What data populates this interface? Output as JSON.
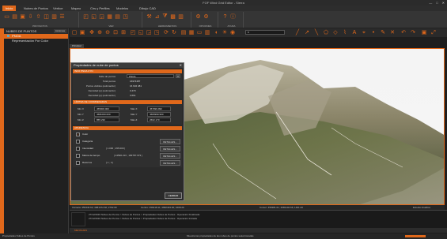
{
  "app": {
    "title": "FOF Wind Grid Editor - Sierra"
  },
  "window_buttons": [
    "—",
    "□",
    "✕"
  ],
  "menu_tabs": [
    "Inicio",
    "Nubes de Puntos",
    "Vértice",
    "Mapeo",
    "Cirs y Perfiles",
    "Modelos",
    "Dibujo CAD"
  ],
  "ribbon": {
    "groups": [
      "PROYECTOS",
      "VER",
      "HERRAMIENTAS",
      "OPCIONES",
      "AYUDA"
    ]
  },
  "left_panel": {
    "title": "NUBES DE PUNTOS",
    "action": "Acciones",
    "items": [
      {
        "label": "PNOA"
      },
      {
        "label": "Representación Por Color"
      }
    ]
  },
  "view_toolbar": {
    "select_value": "8"
  },
  "view_tab": {
    "label": "Principal"
  },
  "dialog": {
    "title": "Propiedades de nube de puntos",
    "close": "✕",
    "section_info": "INFO PNOA CYN",
    "rows": [
      {
        "label": "Nube de puntos",
        "value": "PNOA"
      },
      {
        "label": "Total puntos",
        "value": "16974487"
      },
      {
        "label": "Puntos visibles (estimación)",
        "value": "16 634 481"
      },
      {
        "label": "Densidad (p) (estimación)",
        "value": "0.470"
      },
      {
        "label": "Densidad (p) (estimación)",
        "value": "3.661"
      }
    ],
    "section_limits": "LÍMITES DE COORDENADAS",
    "limits": [
      {
        "l1": "Mín.X",
        "v1": "455000.000",
        "l2": "Máx.X",
        "v2": "457999.990"
      },
      {
        "l1": "Mín.Y",
        "v1": "4681000.000",
        "l2": "Máx.Y",
        "v2": "4683999.990"
      },
      {
        "l1": "Mín.Z",
        "v1": "855.230",
        "l2": "Máx.Z",
        "v2": "2662.170"
      }
    ],
    "section_appearance": "APARIENCIA",
    "appearance": [
      {
        "label": "Color",
        "range": "",
        "detail": ""
      },
      {
        "label": "Categoría",
        "range": "",
        "detail": "DETALLES..."
      },
      {
        "label": "Intensidad",
        "range": "[ 1.000 ; 255.000 ]",
        "detail": "DETALLES..."
      },
      {
        "label": "Marca de tiempo",
        "range": "[ 24596.213 ; 183787.973 ]",
        "detail": "DETALLES..."
      },
      {
        "label": "Retornos",
        "range": "[ 1 ; 4 ]",
        "detail": "DETALLES..."
      }
    ],
    "ok_label": "CERRAR"
  },
  "status_coords": {
    "camera": "Cámara: 456440.64; 4681472.60; 2762.09",
    "center": "Centro: 456418.11; 4682433.30; 1608.29",
    "cursor": "Cursor: 456381.01; 4683102.66; 1401.20",
    "mode": "Estudio Analítico"
  },
  "output": {
    "lines": [
      "27/12/2016 Nubes de Puntos > Nubes de Puntos > Propiedades Nubes de Puntos : Operación Finalizada",
      "27/12/2016 Nubes de Puntos > Nubes de Puntos > Propiedades Nubes de Puntos : Operación Iniciada"
    ],
    "bar_label": "MENSAJES"
  },
  "statusbar": {
    "left": "Propiedades Nubes de Puntos",
    "center": "Muestra las propiedades de las nubes de puntos seleccionadas"
  }
}
